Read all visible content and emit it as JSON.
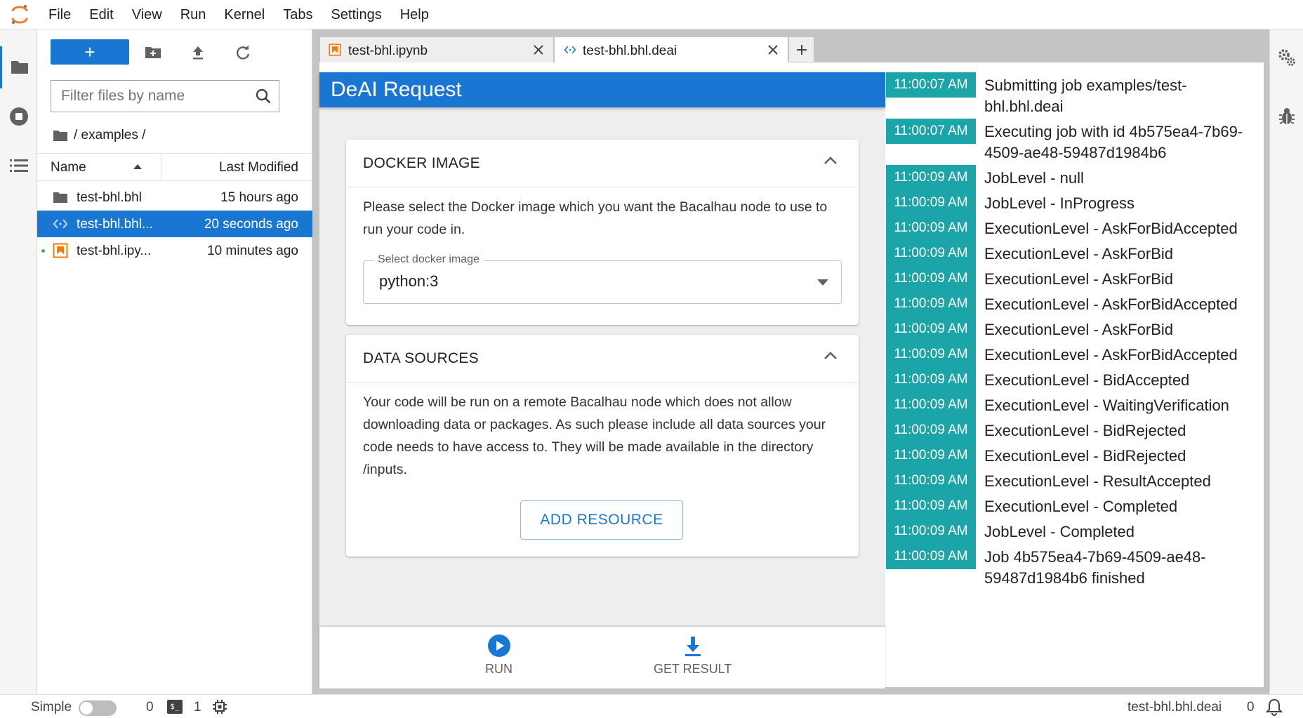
{
  "menu": [
    "File",
    "Edit",
    "View",
    "Run",
    "Kernel",
    "Tabs",
    "Settings",
    "Help"
  ],
  "filebrowser": {
    "new_label": "+",
    "filter_placeholder": "Filter files by name",
    "breadcrumb": "/ examples /",
    "col_name": "Name",
    "col_modified": "Last Modified",
    "files": [
      {
        "name": "test-bhl.bhl",
        "modified": "15 hours ago",
        "icon": "folder-icon",
        "selected": false,
        "running": false
      },
      {
        "name": "test-bhl.bhl...",
        "modified": "20 seconds ago",
        "icon": "deai-file-icon",
        "selected": true,
        "running": false
      },
      {
        "name": "test-bhl.ipy...",
        "modified": "10 minutes ago",
        "icon": "notebook-icon",
        "selected": false,
        "running": true
      }
    ]
  },
  "tabs": [
    {
      "label": "test-bhl.ipynb",
      "active": false
    },
    {
      "label": "test-bhl.bhl.deai",
      "active": true
    }
  ],
  "deai": {
    "title": "DeAI Request",
    "docker": {
      "title": "DOCKER IMAGE",
      "text": "Please select the Docker image which you want the Bacalhau node to use to run your code in.",
      "select_label": "Select docker image",
      "select_value": "python:3"
    },
    "data_sources": {
      "title": "DATA SOURCES",
      "text": "Your code will be run on a remote Bacalhau node which does not allow downloading data or packages. As such please include all data sources your code needs to have access to. They will be made available in the directory /inputs.",
      "add_resource": "ADD RESOURCE"
    },
    "run_label": "RUN",
    "get_result_label": "GET RESULT"
  },
  "log": [
    {
      "time": "11:00:07 AM",
      "message": "Submitting job examples/test-bhl.bhl.deai"
    },
    {
      "time": "11:00:07 AM",
      "message": "Executing job with id 4b575ea4-7b69-4509-ae48-59487d1984b6"
    },
    {
      "time": "11:00:09 AM",
      "message": "JobLevel - null"
    },
    {
      "time": "11:00:09 AM",
      "message": "JobLevel - InProgress"
    },
    {
      "time": "11:00:09 AM",
      "message": "ExecutionLevel - AskForBidAccepted"
    },
    {
      "time": "11:00:09 AM",
      "message": "ExecutionLevel - AskForBid"
    },
    {
      "time": "11:00:09 AM",
      "message": "ExecutionLevel - AskForBid"
    },
    {
      "time": "11:00:09 AM",
      "message": "ExecutionLevel - AskForBidAccepted"
    },
    {
      "time": "11:00:09 AM",
      "message": "ExecutionLevel - AskForBid"
    },
    {
      "time": "11:00:09 AM",
      "message": "ExecutionLevel - AskForBidAccepted"
    },
    {
      "time": "11:00:09 AM",
      "message": "ExecutionLevel - BidAccepted"
    },
    {
      "time": "11:00:09 AM",
      "message": "ExecutionLevel - WaitingVerification"
    },
    {
      "time": "11:00:09 AM",
      "message": "ExecutionLevel - BidRejected"
    },
    {
      "time": "11:00:09 AM",
      "message": "ExecutionLevel - BidRejected"
    },
    {
      "time": "11:00:09 AM",
      "message": "ExecutionLevel - ResultAccepted"
    },
    {
      "time": "11:00:09 AM",
      "message": "ExecutionLevel - Completed"
    },
    {
      "time": "11:00:09 AM",
      "message": "JobLevel - Completed"
    },
    {
      "time": "11:00:09 AM",
      "message": "Job 4b575ea4-7b69-4509-ae48-59487d1984b6 finished"
    }
  ],
  "statusbar": {
    "mode_label": "Simple",
    "kernels_count": "0",
    "terminals_count": "1",
    "terminal_icon_text": "$_",
    "document": "test-bhl.bhl.deai",
    "notifications": "0"
  },
  "colors": {
    "accent": "#1976d2",
    "log_time": "#1ba5a8",
    "notebook": "#f57c00"
  }
}
